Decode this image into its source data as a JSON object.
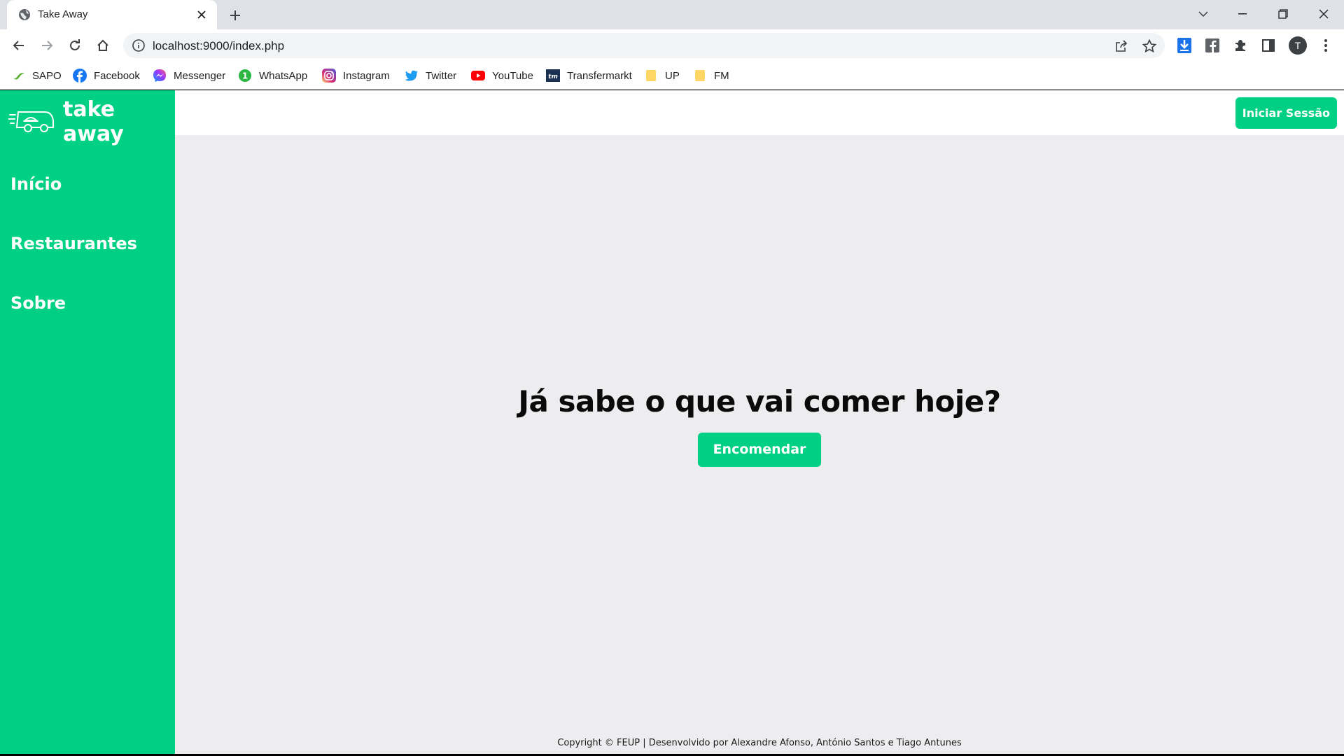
{
  "browser": {
    "tab_title": "Take Away",
    "url": "localhost:9000/index.php",
    "profile_initial": "T",
    "bookmarks": [
      {
        "label": "SAPO",
        "icon": "sapo-icon"
      },
      {
        "label": "Facebook",
        "icon": "facebook-icon"
      },
      {
        "label": "Messenger",
        "icon": "messenger-icon"
      },
      {
        "label": "WhatsApp",
        "icon": "whatsapp-icon"
      },
      {
        "label": "Instagram",
        "icon": "instagram-icon"
      },
      {
        "label": "Twitter",
        "icon": "twitter-icon"
      },
      {
        "label": "YouTube",
        "icon": "youtube-icon"
      },
      {
        "label": "Transfermarkt",
        "icon": "transfermarkt-icon"
      },
      {
        "label": "UP",
        "icon": "folder-icon"
      },
      {
        "label": "FM",
        "icon": "folder-icon"
      }
    ]
  },
  "site": {
    "logo_text": "take away",
    "nav": [
      {
        "label": "Início"
      },
      {
        "label": "Restaurantes"
      },
      {
        "label": "Sobre"
      }
    ],
    "login_label": "Iniciar Sessão",
    "hero_title": "Já sabe o que vai comer hoje?",
    "order_label": "Encomendar",
    "footer": "Copyright © FEUP | Desenvolvido por Alexandre Afonso, António Santos e Tiago Antunes"
  },
  "colors": {
    "brand": "#00d084",
    "page_bg": "#ededef"
  }
}
